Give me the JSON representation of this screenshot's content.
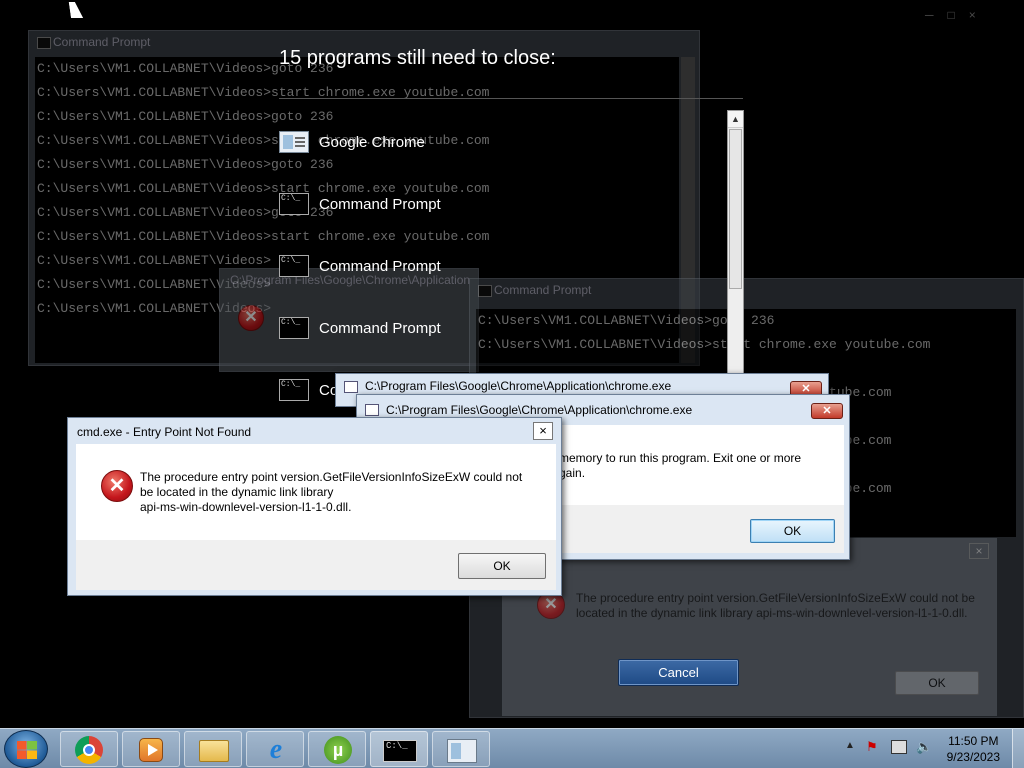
{
  "background_windows": {
    "cmd1": {
      "title": "Command Prompt",
      "lines": [
        "C:\\Users\\VM1.COLLABNET\\Videos>goto 236",
        "C:\\Users\\VM1.COLLABNET\\Videos>start chrome.exe youtube.com",
        "C:\\Users\\VM1.COLLABNET\\Videos>goto 236",
        "C:\\Users\\VM1.COLLABNET\\Videos>start chrome.exe youtube.com",
        "C:\\Users\\VM1.COLLABNET\\Videos>goto 236",
        "C:\\Users\\VM1.COLLABNET\\Videos>start chrome.exe youtube.com",
        "C:\\Users\\VM1.COLLABNET\\Videos>goto 236",
        "C:\\Users\\VM1.COLLABNET\\Videos>start chrome.exe youtube.com",
        "C:\\Users\\VM1.COLLABNET\\Videos>",
        "C:\\Users\\VM1.COLLABNET\\Videos>",
        "C:\\Users\\VM1.COLLABNET\\Videos>"
      ]
    },
    "chrome_app_title": "C:\\Program Files\\Google\\Chrome\\Application",
    "cmd2": {
      "title": "Command Prompt",
      "lines": [
        "C:\\Users\\VM1.COLLABNET\\Videos>goto 236",
        "C:\\Users\\VM1.COLLABNET\\Videos>start chrome.exe youtube.com",
        "",
        "                                          youtube.com",
        "",
        "                                          youtube.com",
        "",
        "                                          youtube.com"
      ]
    },
    "ghost_error": {
      "text": "The procedure entry point version.GetFileVersionInfoSizeExW could not be located in the dynamic link library api-ms-win-downlevel-version-l1-1-0.dll.",
      "ok": "OK"
    }
  },
  "shutdown": {
    "title": "15 programs still need to close:",
    "programs": [
      {
        "label": "Google Chrome",
        "icon": "chrome-app-icon"
      },
      {
        "label": "Command Prompt",
        "icon": "cmd-icon"
      },
      {
        "label": "Command Prompt",
        "icon": "cmd-icon"
      },
      {
        "label": "Command Prompt",
        "icon": "cmd-icon"
      },
      {
        "label": "Co",
        "icon": "cmd-icon"
      }
    ],
    "cancel": "Cancel"
  },
  "chrome_dialog_back": {
    "title": "C:\\Program Files\\Google\\Chrome\\Application\\chrome.exe"
  },
  "chrome_dialog_front": {
    "title": "C:\\Program Files\\Google\\Chrome\\Application\\chrome.exe",
    "line1": "memory to run this program. Exit one or more",
    "line2": "gain.",
    "ok": "OK"
  },
  "error_dialog": {
    "title": "cmd.exe - Entry Point Not Found",
    "line1": "The procedure entry point version.GetFileVersionInfoSizeExW could not",
    "line2": "be located in the dynamic link library",
    "line3": "api-ms-win-downlevel-version-l1-1-0.dll.",
    "ok": "OK",
    "close": "×"
  },
  "taskbar": {
    "clock_time": "11:50 PM",
    "clock_date": "9/23/2023",
    "apps": [
      "start",
      "chrome",
      "media-player",
      "explorer",
      "internet-explorer",
      "utorrent",
      "cmd",
      "app-window"
    ]
  },
  "colors": {
    "accent": "#3c7fb1",
    "error_red": "#c4161c",
    "taskbar": "#7f9ab8"
  }
}
